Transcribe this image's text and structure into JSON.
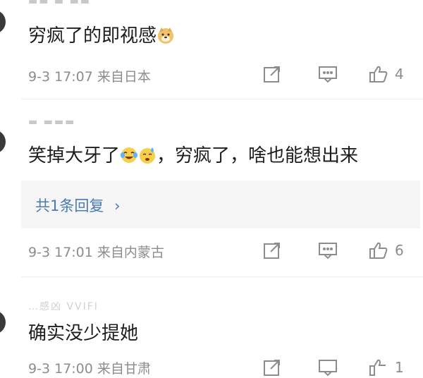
{
  "comments": [
    {
      "name": "",
      "text": "穷疯了的即视感",
      "emojis": [
        "doge"
      ],
      "meta": "9-3 17:07 来自日本",
      "likes": "4"
    },
    {
      "name": "",
      "text_before": "笑掉大牙了",
      "text_after": "，穷疯了，啥也能想出来",
      "emojis": [
        "laugh-cry",
        "sweat-face"
      ],
      "replies_label": "共1条回复",
      "replies_chevron": "›",
      "meta": "9-3 17:01 来自内蒙古",
      "likes": "6"
    },
    {
      "name": "…感凶 VVIFI",
      "text": "确实没少提她",
      "meta": "9-3 17:00 来自甘肃",
      "likes": "1"
    }
  ],
  "icons": {
    "share": "share-icon",
    "comment": "comment-icon",
    "like": "like-icon"
  },
  "colors": {
    "meta": "#8c8c8c",
    "link": "#4a7ab0",
    "reply_bg": "#f5f5f5"
  }
}
